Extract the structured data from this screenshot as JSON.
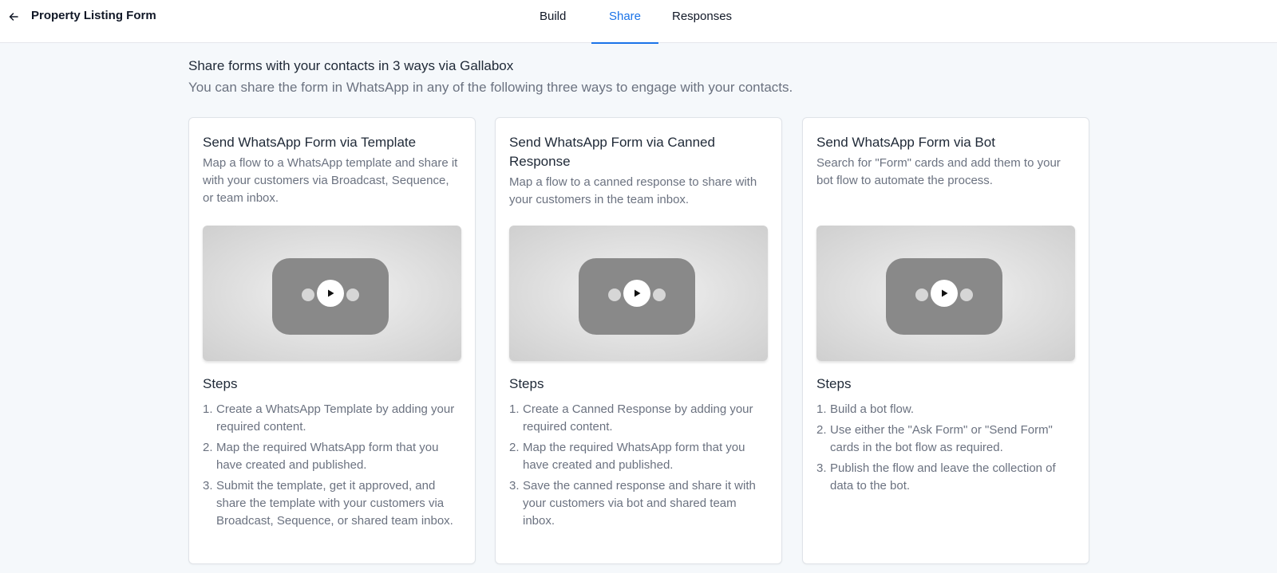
{
  "header": {
    "back_icon": "arrow-left-icon",
    "title": "Property Listing Form",
    "tabs": [
      {
        "label": "Build",
        "active": false
      },
      {
        "label": "Share",
        "active": true
      },
      {
        "label": "Responses",
        "active": false
      }
    ],
    "accent_color": "#1a73e8"
  },
  "intro": {
    "title": "Share forms with your contacts in 3 ways via Gallabox",
    "subtitle": "You can share the form in WhatsApp in any of the following three ways to engage with your contacts."
  },
  "cards": [
    {
      "title": "Send WhatsApp Form via Template",
      "description": "Map a flow to a WhatsApp template and share it with your customers via Broadcast, Sequence, or team inbox.",
      "video_icon": "play-icon",
      "steps_title": "Steps",
      "steps": [
        {
          "num": "1.",
          "text": "Create a WhatsApp Template by adding your required content."
        },
        {
          "num": "2.",
          "text": "Map the required WhatsApp form that you have created and published."
        },
        {
          "num": "3.",
          "text": "Submit the template, get it approved, and share the template with your customers via Broadcast, Sequence, or shared team inbox."
        }
      ]
    },
    {
      "title": "Send WhatsApp Form via Canned Response",
      "description": "Map a flow to a canned response to share with your customers in the team inbox.",
      "video_icon": "play-icon",
      "steps_title": "Steps",
      "steps": [
        {
          "num": "1.",
          "text": "Create a Canned Response by adding your required content."
        },
        {
          "num": "2.",
          "text": "Map the required WhatsApp form that you have created and published."
        },
        {
          "num": "3.",
          "text": "Save the canned response and share it with your customers via bot and shared team inbox."
        }
      ]
    },
    {
      "title": "Send WhatsApp Form via Bot",
      "description": "Search for \"Form\" cards and add them to your bot flow to automate the process.",
      "video_icon": "play-icon",
      "steps_title": "Steps",
      "steps": [
        {
          "num": "1.",
          "text": "Build a bot flow."
        },
        {
          "num": "2.",
          "text": "Use either the \"Ask Form\" or \"Send Form\" cards in the bot flow as required."
        },
        {
          "num": "3.",
          "text": "Publish the flow and leave the collection of data to the bot."
        }
      ]
    }
  ]
}
